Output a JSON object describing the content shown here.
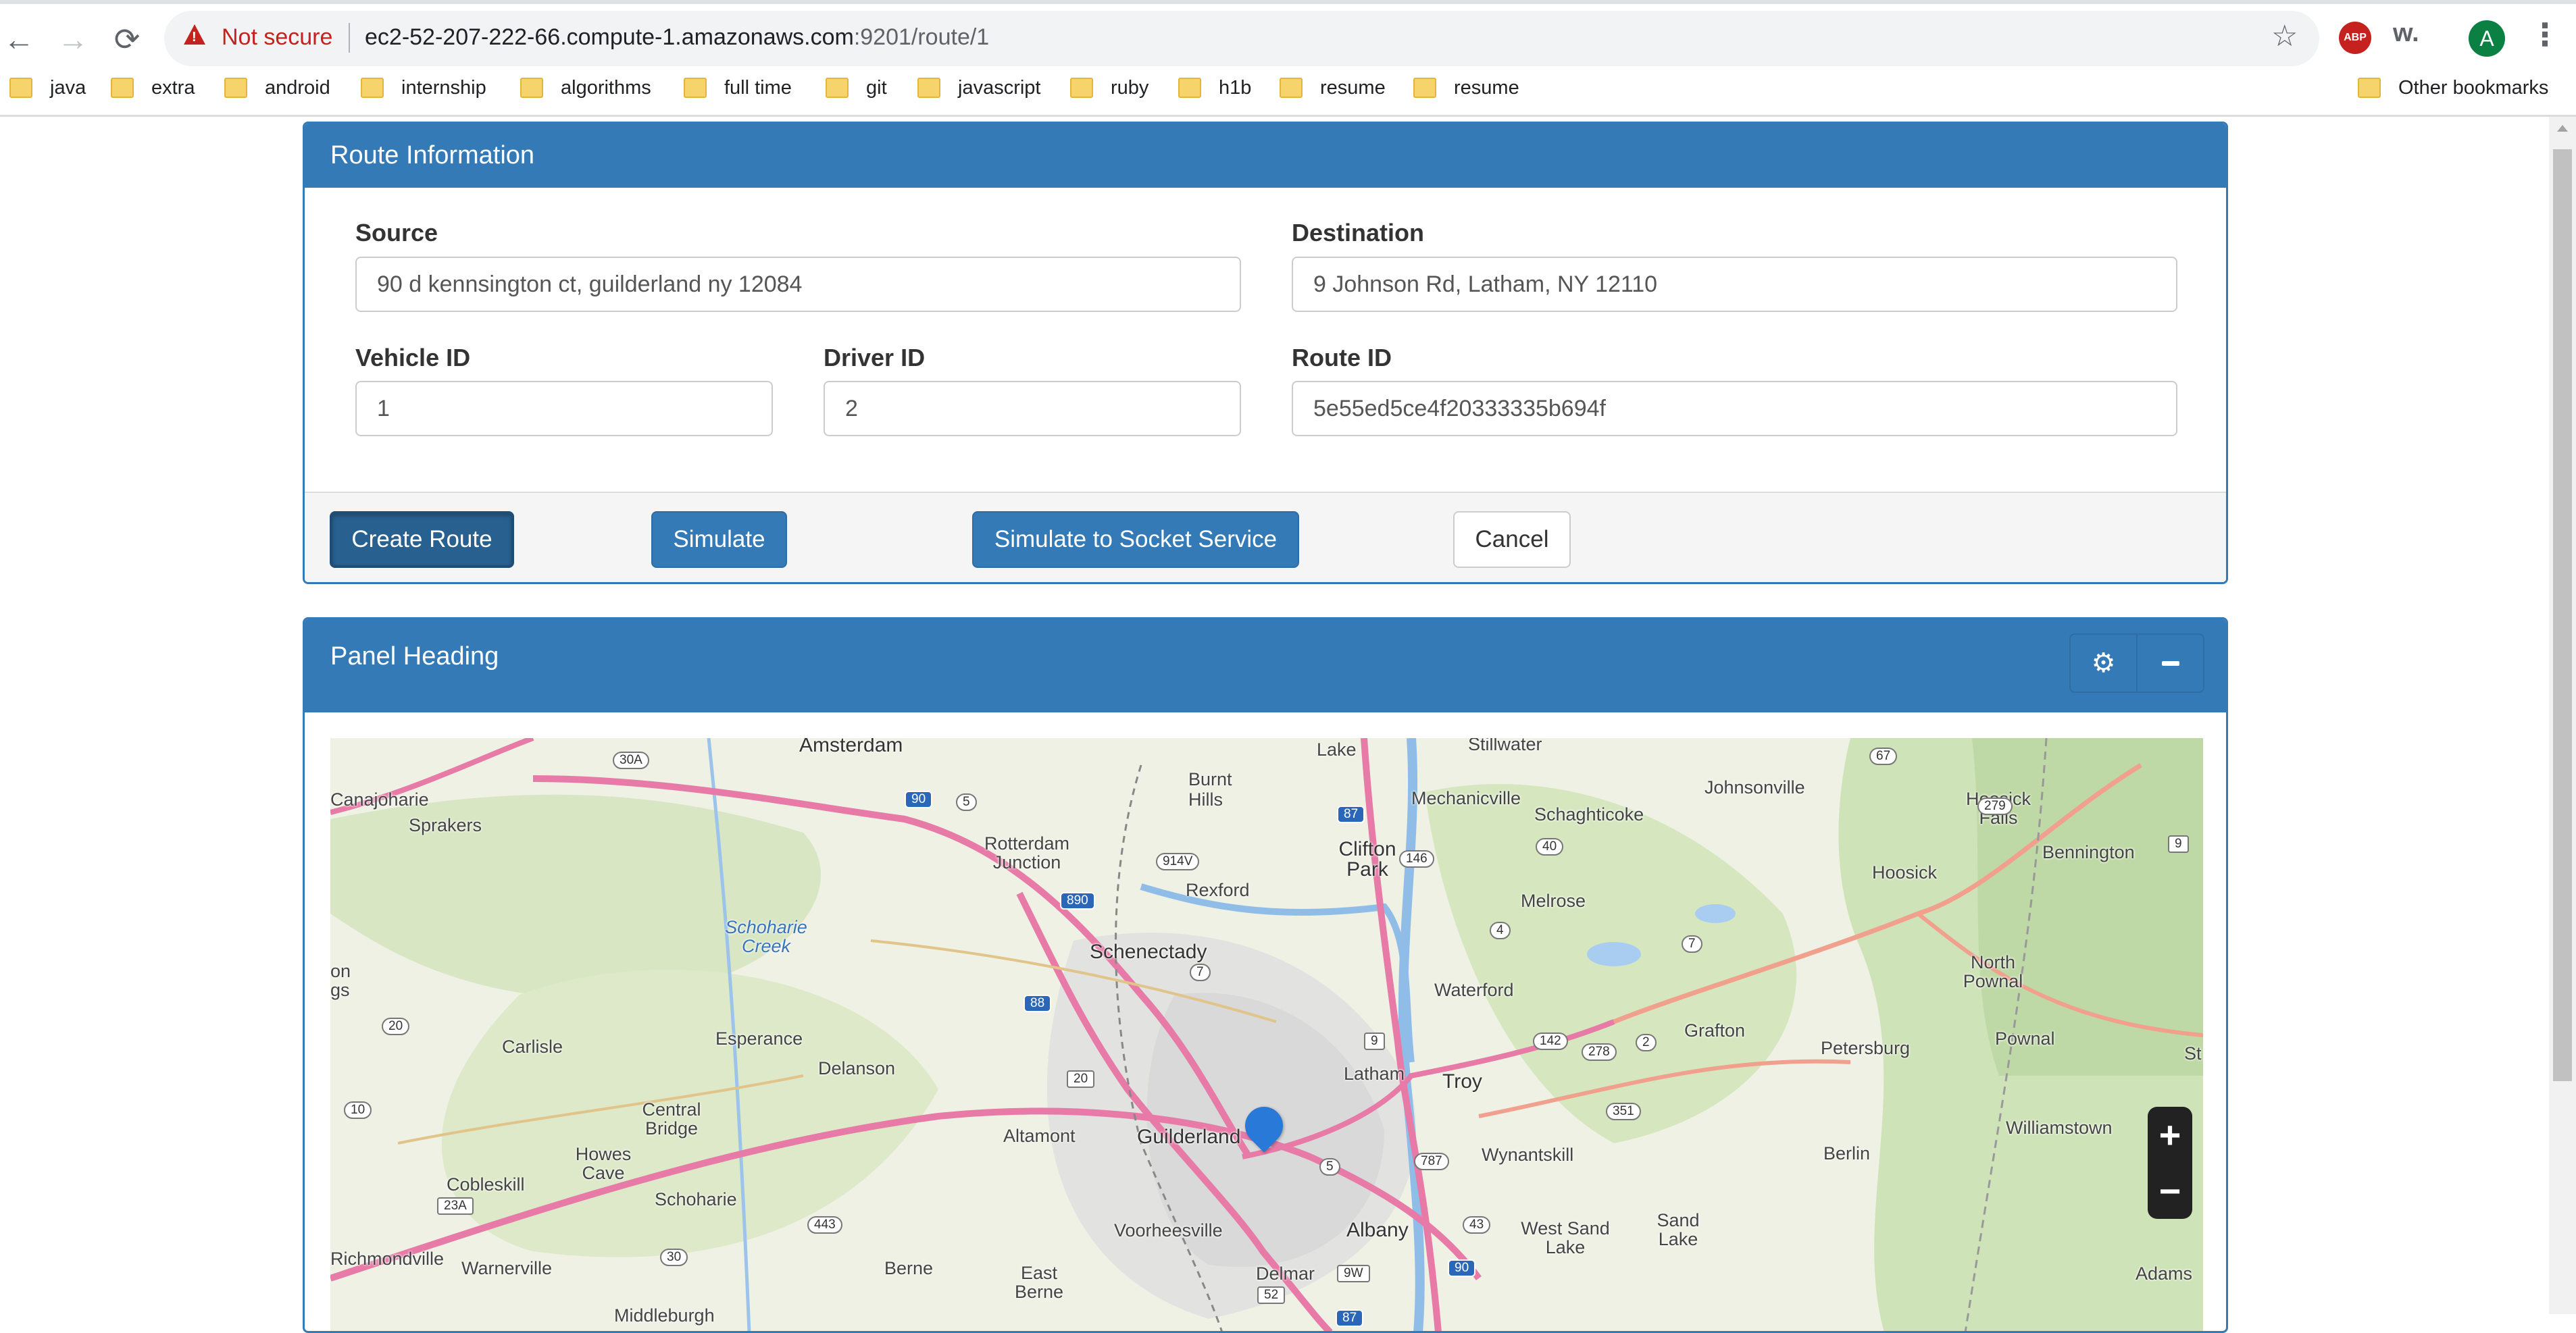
{
  "browser": {
    "security_label": "Not secure",
    "url_host": "ec2-52-207-222-66.compute-1.amazonaws.com",
    "url_rest": ":9201/route/1",
    "profile_initial": "A",
    "ext_abp": "ABP",
    "ext_w": "w.",
    "bookmarks": [
      "java",
      "extra",
      "android",
      "internship",
      "algorithms",
      "full time",
      "git",
      "javascript",
      "ruby",
      "h1b",
      "resume",
      "resume"
    ],
    "other_bookmarks": "Other bookmarks"
  },
  "route_panel": {
    "title": "Route Information",
    "source_label": "Source",
    "source_value": "90 d kennsington ct, guilderland ny 12084",
    "destination_label": "Destination",
    "destination_value": "9 Johnson Rd, Latham, NY 12110",
    "vehicle_label": "Vehicle ID",
    "vehicle_value": "1",
    "driver_label": "Driver ID",
    "driver_value": "2",
    "route_label": "Route ID",
    "route_value": "5e55ed5ce4f20333335b694f",
    "buttons": {
      "create": "Create Route",
      "simulate": "Simulate",
      "socket": "Simulate to Socket Service",
      "cancel": "Cancel"
    }
  },
  "map_panel": {
    "title": "Panel Heading",
    "zoom_in": "+",
    "zoom_out": "−",
    "labels": {
      "amsterdam": "Amsterdam",
      "stillwater": "Stillwater",
      "lake": "Lake",
      "canajoharie": "Canajoharie",
      "sprakers": "Sprakers",
      "burnt_hills": "Burnt Hills",
      "mechanicville": "Mechanicville",
      "johnsonville": "Johnsonville",
      "hoosick_falls": "Hoosick Falls",
      "schaghticoke": "Schaghticoke",
      "bennington": "Bennington",
      "rotterdam": "Rotterdam Junction",
      "clifton_park": "Clifton Park",
      "rexford": "Rexford",
      "hoosick": "Hoosick",
      "schoharie_creek": "Schoharie Creek",
      "melrose": "Melrose",
      "schenectady": "Schenectady",
      "north_pownal": "North Pownal",
      "on": "on",
      "gs": "gs",
      "waterford": "Waterford",
      "carlisle": "Carlisle",
      "esperance": "Esperance",
      "grafton": "Grafton",
      "petersburg": "Petersburg",
      "pownal": "Pownal",
      "delanson": "Delanson",
      "latham": "Latham",
      "troy": "Troy",
      "st": "St",
      "central_bridge": "Central Bridge",
      "altamont": "Altamont",
      "guilderland": "Guilderland",
      "williamstown": "Williamstown",
      "howes_cave": "Howes Cave",
      "wynantskill": "Wynantskill",
      "berlin": "Berlin",
      "cobleskill": "Cobleskill",
      "schoharie": "Schoharie",
      "voorheesville": "Voorheesville",
      "albany": "Albany",
      "west_sand_lake": "West Sand Lake",
      "sand_lake": "Sand Lake",
      "richmondville": "Richmondville",
      "warnerville": "Warnerville",
      "berne": "Berne",
      "east_berne": "East Berne",
      "delmar": "Delmar",
      "adams": "Adams",
      "middleburgh": "Middleburgh"
    },
    "shields": {
      "s30a": "30A",
      "s90a": "90",
      "s5a": "5",
      "s87a": "87",
      "s67": "67",
      "s279": "279",
      "s9a": "9",
      "s914v": "914V",
      "s146": "146",
      "s40": "40",
      "s890": "890",
      "s4": "4",
      "s7a": "7",
      "s7b": "7",
      "s88": "88",
      "s20a": "20",
      "s9b": "9",
      "s142": "142",
      "s278": "278",
      "s2": "2",
      "s20b": "20",
      "s10": "10",
      "s351": "351",
      "s787": "787",
      "s5b": "5",
      "s23a": "23A",
      "s443": "443",
      "s43": "43",
      "s30b": "30",
      "s9w": "9W",
      "s90b": "90",
      "s52": "52",
      "s87b": "87"
    }
  }
}
